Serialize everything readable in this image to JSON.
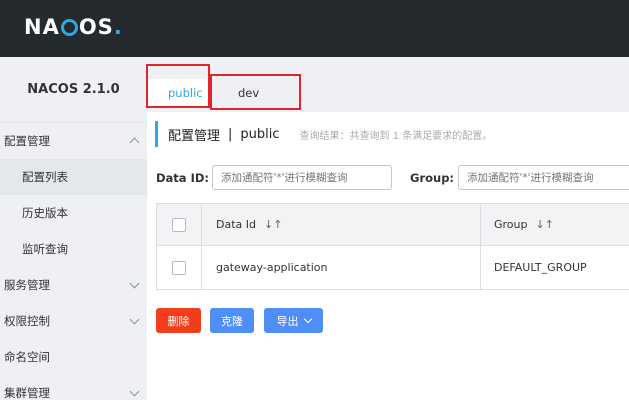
{
  "app": {
    "logo_prefix": "NA",
    "logo_suffix": "OS",
    "logo_dot": ".",
    "version": "NACOS 2.1.0"
  },
  "sidebar": {
    "items": [
      {
        "label": "配置管理",
        "expanded": true
      },
      {
        "label": "配置列表",
        "sub": true,
        "active": true
      },
      {
        "label": "历史版本",
        "sub": true
      },
      {
        "label": "监听查询",
        "sub": true
      },
      {
        "label": "服务管理",
        "expanded": false
      },
      {
        "label": "权限控制",
        "expanded": false
      },
      {
        "label": "命名空间"
      },
      {
        "label": "集群管理",
        "expanded": false
      }
    ]
  },
  "tabs": [
    {
      "label": "public",
      "active": true
    },
    {
      "label": "dev",
      "active": false
    }
  ],
  "header": {
    "title": "配置管理",
    "separator": "|",
    "namespace": "public",
    "result_text": "查询结果：共查询到 1 条满足要求的配置。"
  },
  "search": {
    "data_id_label": "Data ID:",
    "data_id_placeholder": "添加通配符'*'进行模糊查询",
    "group_label": "Group:",
    "group_placeholder": "添加通配符'*'进行模糊查询"
  },
  "table": {
    "columns": [
      "Data Id",
      "Group"
    ],
    "sort_glyph": "↓↑",
    "rows": [
      {
        "data_id": "gateway-application",
        "group": "DEFAULT_GROUP"
      }
    ]
  },
  "actions": {
    "delete": "删除",
    "clone": "克隆",
    "export": "导出"
  },
  "colors": {
    "accent": "#2fa8e6",
    "topbar": "#252a2f",
    "delete": "#f23d1b",
    "primary": "#4f8ef7",
    "highlight_box": "#e0262a"
  }
}
